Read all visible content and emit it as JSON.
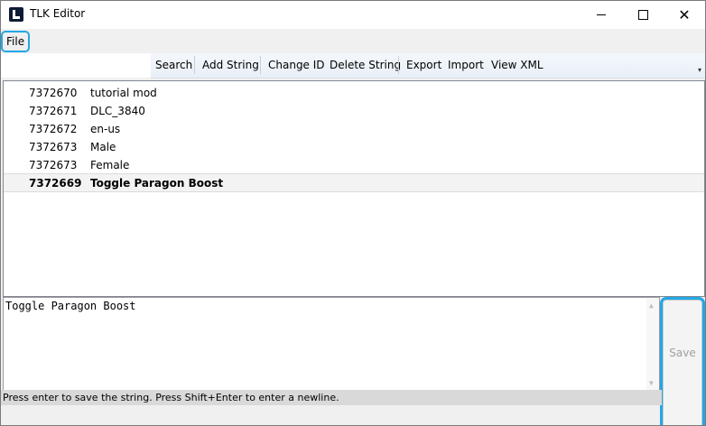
{
  "window": {
    "title": "TLK Editor",
    "icons": {
      "app": "app-logo-icon",
      "minimize": "minimize-icon",
      "maximize": "maximize-icon",
      "close": "close-icon"
    },
    "close_glyph": "✕"
  },
  "menu": {
    "file_label": "File"
  },
  "toolbar": {
    "search": "Search",
    "add_string": "Add String",
    "change_id": "Change ID",
    "delete_string": "Delete String",
    "export": "Export",
    "import": "Import",
    "view_xml": "View XML",
    "overflow_glyph": "▾"
  },
  "list": {
    "rows": [
      {
        "id": "7372670",
        "text": "tutorial mod"
      },
      {
        "id": "7372671",
        "text": "DLC_3840"
      },
      {
        "id": "7372672",
        "text": "en-us"
      },
      {
        "id": "7372673",
        "text": "Male"
      },
      {
        "id": "7372673",
        "text": "Female"
      },
      {
        "id": "7372669",
        "text": "Toggle Paragon Boost"
      }
    ]
  },
  "editor": {
    "value": "Toggle Paragon Boost",
    "scroll_up_glyph": "▲",
    "scroll_down_glyph": "▼"
  },
  "save_button": {
    "label": "Save",
    "enabled": false
  },
  "status": {
    "text": "Press enter to save the string. Press Shift+Enter to enter a newline."
  },
  "colors": {
    "highlight": "#22a7e6",
    "toolbar_bg": "#eef3fa",
    "status_bg": "#d9d9d9"
  }
}
